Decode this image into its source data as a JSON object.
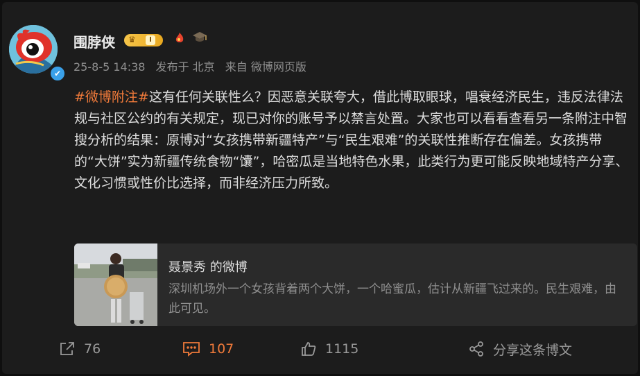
{
  "post": {
    "username": "围脖侠",
    "level": "I",
    "verified_mark": "✔",
    "meta": {
      "date": "25-8-5 14:38",
      "location": "发布于 北京",
      "source": "来自 微博网页版"
    },
    "hashtag": "#微博附注#",
    "text": "这有任何关联性么？因恶意关联夸大，借此博取眼球，唱衰经济民生，违反法律法规与社区公约的有关规定，现已对你的账号予以禁言处置。大家也可以看看查看另一条附注中智搜分析的结果：原博对“女孩携带新疆特产”与“民生艰难”的关联性推断存在偏差。女孩携带的“大饼”实为新疆传统食物“馕”，哈密瓜是当地特色水果，此类行为更可能反映地域特产分享、文化习惯或性价比选择，而非经济压力所致。"
  },
  "quoted": {
    "title": "聂景秀 的微博",
    "text": "深圳机场外一个女孩背着两个大饼，一个哈蜜瓜，估计从新疆飞过来的。民生艰难，由此可见。"
  },
  "actions": {
    "repost": "76",
    "comment": "107",
    "like": "1115",
    "share": "分享这条博文"
  },
  "icons": {
    "avatar": "weibo-eye-logo",
    "badge_1": "flame-icon",
    "badge_2": "graduation-cap-icon",
    "repost": "repost-icon",
    "comment": "comment-icon",
    "like": "thumbs-up-icon",
    "share": "share-icon"
  },
  "colors": {
    "accent": "#f07a3a",
    "background": "#1c1c1c",
    "verified": "#3aa0e8"
  }
}
